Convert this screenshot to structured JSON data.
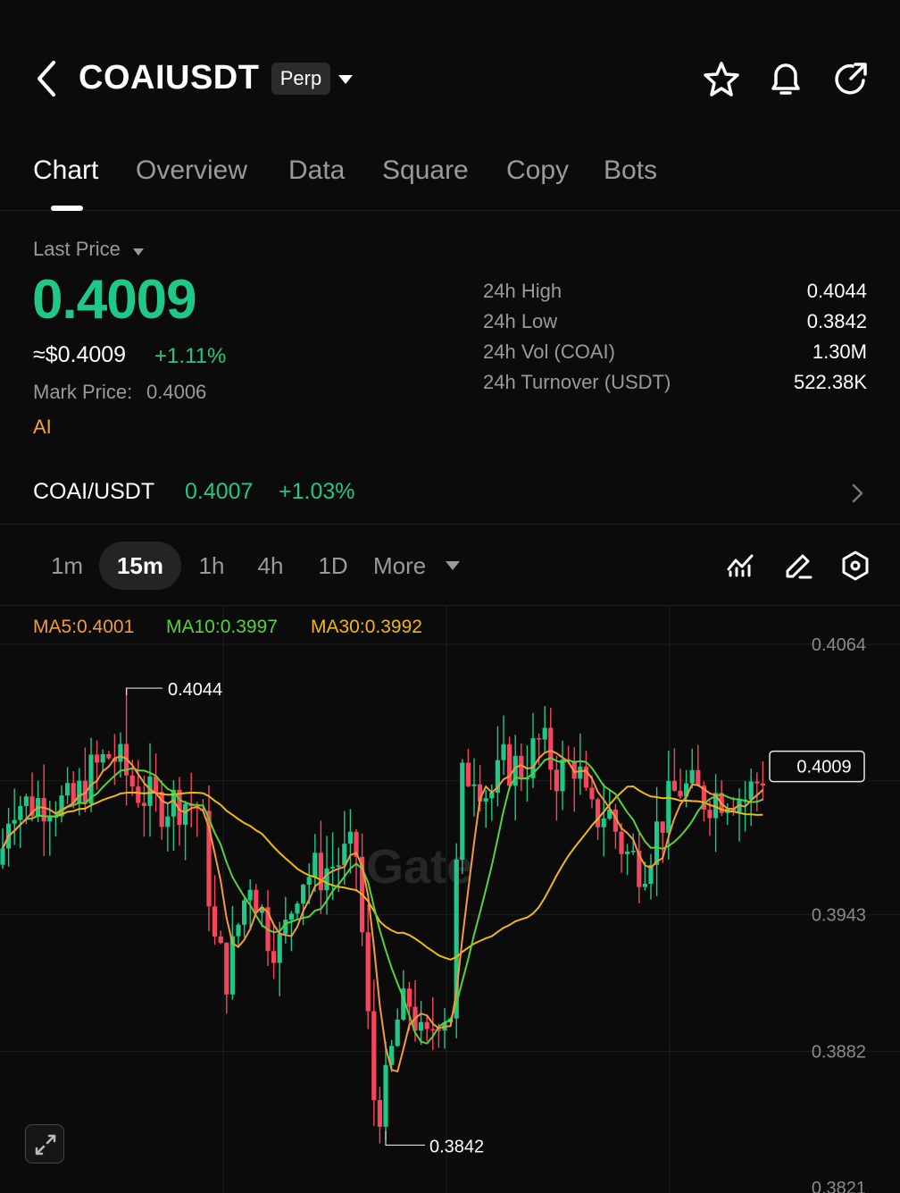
{
  "header": {
    "symbol": "COAIUSDT",
    "badge": "Perp",
    "icons": [
      "back-icon",
      "star-icon",
      "bell-icon",
      "share-icon"
    ]
  },
  "tabs": [
    "Chart",
    "Overview",
    "Data",
    "Square",
    "Copy",
    "Bots"
  ],
  "price": {
    "label": "Last Price",
    "last": "0.4009",
    "usd": "≈$0.4009",
    "change": "+1.11%",
    "mark_label": "Mark Price:",
    "mark_value": "0.4006",
    "tag": "AI"
  },
  "stats": [
    {
      "label": "24h  High",
      "value": "0.4044"
    },
    {
      "label": "24h  Low",
      "value": "0.3842"
    },
    {
      "label": "24h  Vol (COAI)",
      "value": "1.30M"
    },
    {
      "label": "24h  Turnover (USDT)",
      "value": "522.38K"
    }
  ],
  "spot": {
    "pair": "COAI/USDT",
    "price": "0.4007",
    "change": "+1.03%"
  },
  "intervals": [
    "1m",
    "15m",
    "1h",
    "4h",
    "1D"
  ],
  "selected_interval": "15m",
  "more_label": "More",
  "ma": {
    "ma5": "MA5:0.4001",
    "ma10": "MA10:0.3997",
    "ma30": "MA30:0.3992"
  },
  "colors": {
    "up": "#1fc887",
    "down": "#f6465d",
    "ma5": "#f39b3a",
    "ma10": "#58d23c",
    "ma30": "#f0b90b",
    "bg": "#0b0b0b"
  },
  "chart_data": {
    "type": "candlestick",
    "y_ticks": [
      "0.4064",
      "0.3943",
      "0.3882",
      "0.3821"
    ],
    "high_marker": "0.4044",
    "low_marker": "0.3842",
    "current_price_label": "0.4009",
    "ylim": [
      0.3821,
      0.4064
    ],
    "watermark": "Gate"
  }
}
